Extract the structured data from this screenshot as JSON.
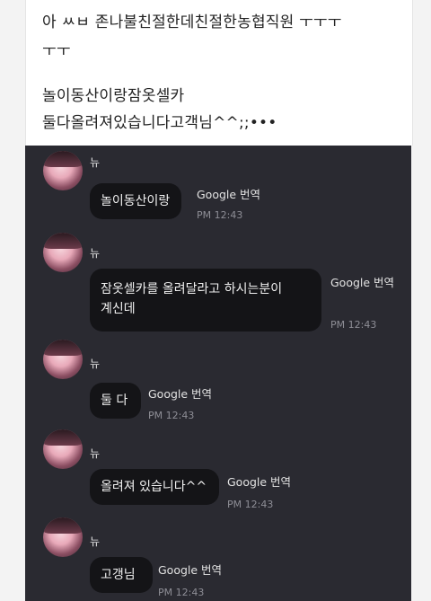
{
  "post": {
    "line1": "아 ㅆㅂ 존나불친절한데친절한농협직원 ㅜㅜㅜ",
    "line2": "ㅜㅜ",
    "line3": "놀이동산이랑잠옷셀카",
    "line4": "둘다올려져있습니다고객님^^;;•••"
  },
  "chat": {
    "sender": "뉴",
    "translate_label": "Google 번역",
    "messages": [
      {
        "text_lines": [
          "놀이동산이랑"
        ],
        "time": "PM 12:43"
      },
      {
        "text_lines": [
          "잠옷셀카를 올려달라고 하시는분이",
          "계신데"
        ],
        "time": "PM 12:43"
      },
      {
        "text_lines": [
          "둘 다"
        ],
        "time": "PM 12:43"
      },
      {
        "text_lines": [
          "올려져 있습니다^^"
        ],
        "time": "PM 12:43"
      },
      {
        "text_lines": [
          "고갱님"
        ],
        "time": "PM 12:43"
      }
    ]
  },
  "colors": {
    "chat_bg": "#2a2a31",
    "bubble_bg": "#141417",
    "post_bg": "#ffffff"
  }
}
